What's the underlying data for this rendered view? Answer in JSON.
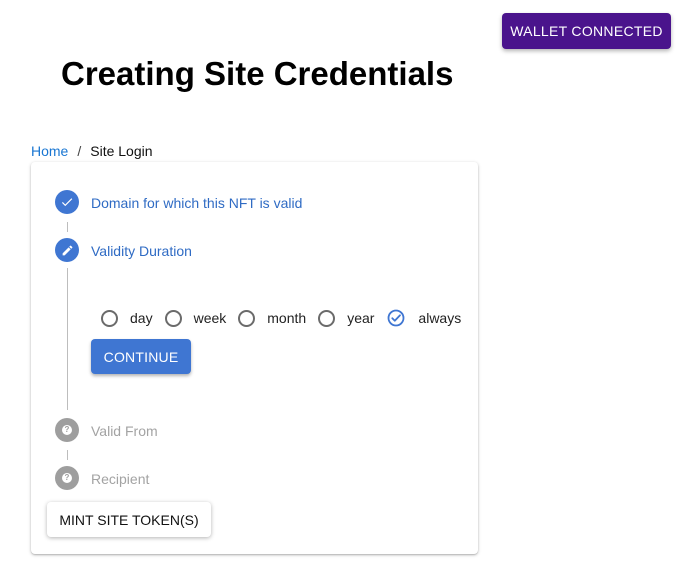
{
  "header": {
    "wallet_button": "WALLET CONNECTED",
    "title": "Creating Site Credentials"
  },
  "breadcrumb": {
    "home": "Home",
    "separator": "/",
    "current": "Site Login"
  },
  "stepper": {
    "steps": [
      {
        "label": "Domain for which this NFT is valid",
        "status": "completed",
        "icon": "check-icon"
      },
      {
        "label": "Validity Duration",
        "status": "active",
        "icon": "pencil-icon"
      },
      {
        "label": "Valid From",
        "status": "pending",
        "icon": "help-icon"
      },
      {
        "label": "Recipient",
        "status": "pending",
        "icon": "help-icon"
      }
    ],
    "duration_options": [
      {
        "label": "day",
        "selected": false
      },
      {
        "label": "week",
        "selected": false
      },
      {
        "label": "month",
        "selected": false
      },
      {
        "label": "year",
        "selected": false
      },
      {
        "label": "always",
        "selected": true
      }
    ],
    "continue_button": "CONTINUE"
  },
  "mint_button": "MINT SITE TOKEN(S)",
  "colors": {
    "wallet_button_bg": "#4a148c",
    "primary": "#3f76d2",
    "link": "#1976d2",
    "inactive": "#9e9e9e"
  }
}
